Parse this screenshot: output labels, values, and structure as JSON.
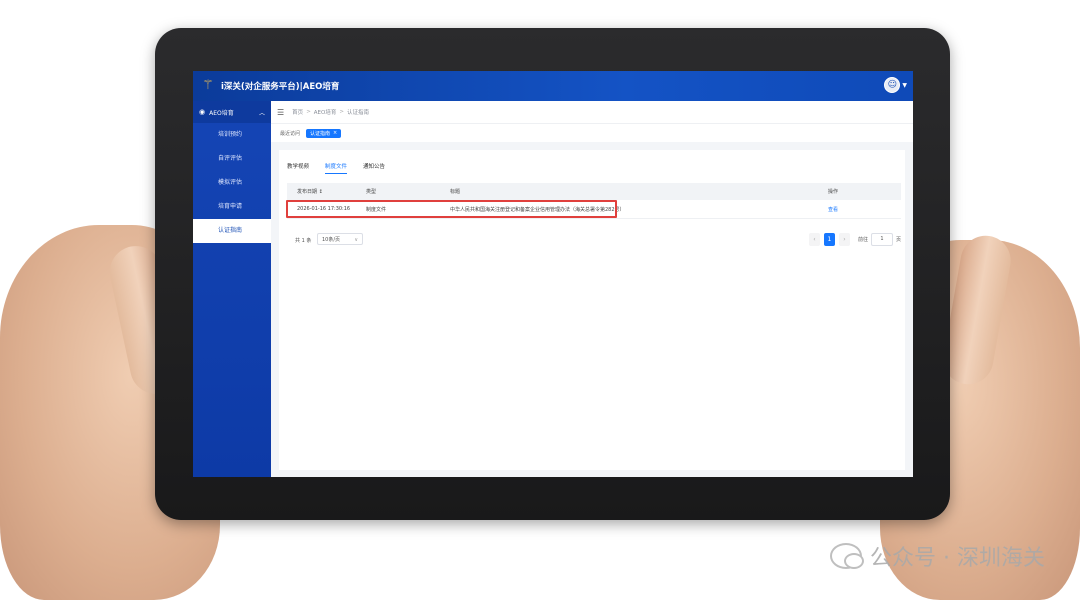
{
  "header": {
    "app_title": "i深关(对企服务平台)|AEO培育",
    "logo_icon": "customs-emblem-icon",
    "user_icon": "user-avatar-icon"
  },
  "sidebar": {
    "group_label": "AEO培育",
    "items": [
      {
        "label": "培训预约",
        "active": false
      },
      {
        "label": "自评评估",
        "active": false
      },
      {
        "label": "模拟评估",
        "active": false
      },
      {
        "label": "培育申请",
        "active": false
      },
      {
        "label": "认证指南",
        "active": true
      }
    ]
  },
  "breadcrumb": {
    "items": [
      "首页",
      "AEO培育",
      "认证指南"
    ]
  },
  "tagbar": {
    "label": "最近访问",
    "tag": "认证指南"
  },
  "tabs": [
    {
      "label": "教学视频",
      "active": false
    },
    {
      "label": "制度文件",
      "active": true
    },
    {
      "label": "通知公告",
      "active": false
    }
  ],
  "table": {
    "headers": [
      "发布日期 ↕",
      "类型",
      "标题",
      "操作"
    ],
    "rows": [
      {
        "date": "2026-01-16 17:30:16",
        "type": "制度文件",
        "title": "中华人民共和国海关注册登记和备案企业信用管理办法（海关总署令第282号）",
        "action": "查看"
      }
    ]
  },
  "pagination": {
    "total": "共 1 条",
    "page_size": "10条/页",
    "current_page": "1",
    "goto_label": "前往",
    "goto_value": "1",
    "page_unit": "页"
  },
  "watermark": {
    "text": "公众号 · 深圳海关"
  }
}
